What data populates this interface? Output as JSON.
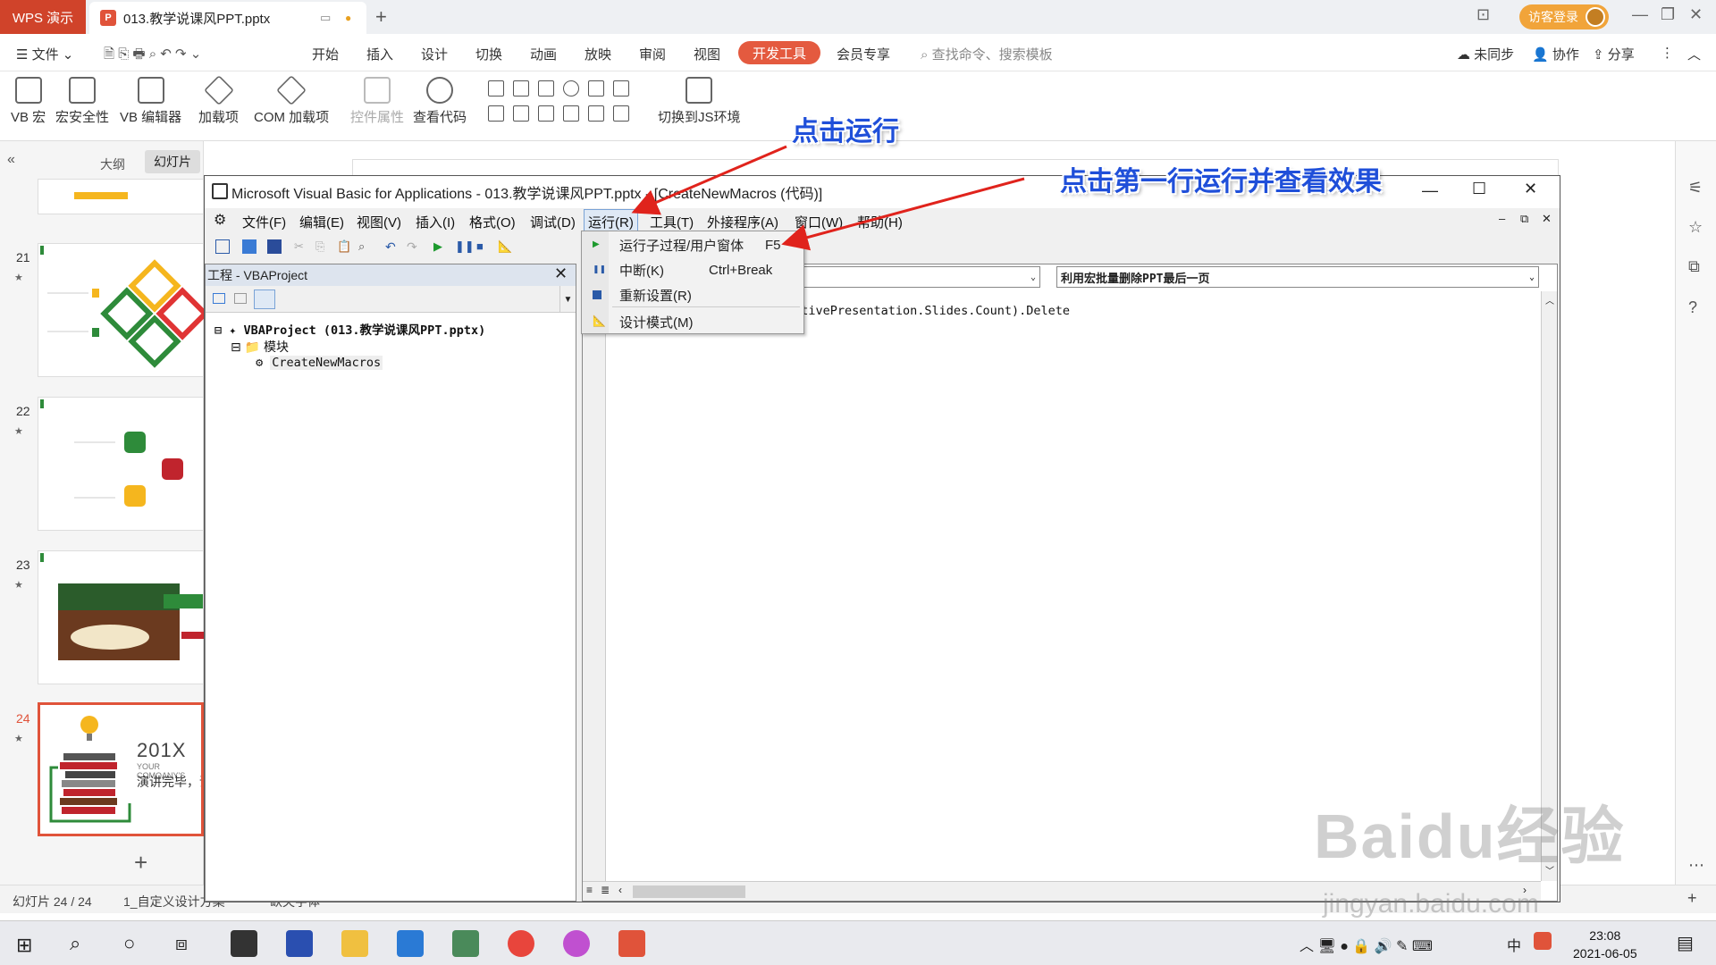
{
  "wps": {
    "brand": "WPS 演示",
    "doc_tab": "013.教学说课风PPT.pptx",
    "login": "访客登录",
    "menu": {
      "file": "文件",
      "tabs": [
        "开始",
        "插入",
        "设计",
        "切换",
        "动画",
        "放映",
        "审阅",
        "视图"
      ],
      "active_tab": "开发工具",
      "member": "会员专享",
      "search": "查找命令、搜索模板",
      "sync": "未同步",
      "collab": "协作",
      "share": "分享"
    },
    "ribbon": {
      "vb_macro": "VB 宏",
      "macro_security": "宏安全性",
      "vb_editor": "VB 编辑器",
      "addins": "加载项",
      "com_addins": "COM 加载项",
      "control_props": "控件属性",
      "view_code": "查看代码",
      "js_env": "切换到JS环境"
    },
    "panel_tabs": {
      "outline": "大纲",
      "slides": "幻灯片"
    },
    "slides": [
      "21",
      "22",
      "23",
      "24"
    ],
    "thumb24": {
      "year": "201X",
      "company": "YOUR COMOANY'S",
      "thanks": "演讲完毕，谢"
    },
    "status": {
      "slide": "幻灯片 24 / 24",
      "design": "1_自定义设计方案",
      "font": "缺失字体"
    }
  },
  "vba": {
    "title": "Microsoft Visual Basic for Applications - 013.教学说课风PPT.pptx - [CreateNewMacros (代码)]",
    "menus": [
      "文件(F)",
      "编辑(E)",
      "视图(V)",
      "插入(I)",
      "格式(O)",
      "调试(D)",
      "运行(R)",
      "工具(T)",
      "外接程序(A)",
      "窗口(W)",
      "帮助(H)"
    ],
    "project_title": "工程 - VBAProject",
    "project_root": "VBAProject (013.教学说课风PPT.pptx)",
    "modules_folder": "模块",
    "module": "CreateNewMacros",
    "proc_combo": "利用宏批量删除PPT最后一页",
    "code_line": "ActivePresentation.Slides.Count).Delete",
    "run_menu": [
      {
        "label": "运行子过程/用户窗体",
        "shortcut": "F5"
      },
      {
        "label": "中断(K)",
        "shortcut": "Ctrl+Break"
      },
      {
        "label": "重新设置(R)",
        "shortcut": ""
      },
      {
        "label": "设计模式(M)",
        "shortcut": ""
      }
    ]
  },
  "annotations": {
    "click_run": "点击运行",
    "click_first": "点击第一行运行并查看效果"
  },
  "taskbar": {
    "time": "23:08",
    "date": "2021-06-05",
    "ime": "中"
  },
  "watermark": "Baidu经验",
  "watermark_url": "jingyan.baidu.com",
  "colors": {
    "accent": "#e45a3f",
    "annotation": "#1f4fd9",
    "arrow": "#e0231c"
  }
}
